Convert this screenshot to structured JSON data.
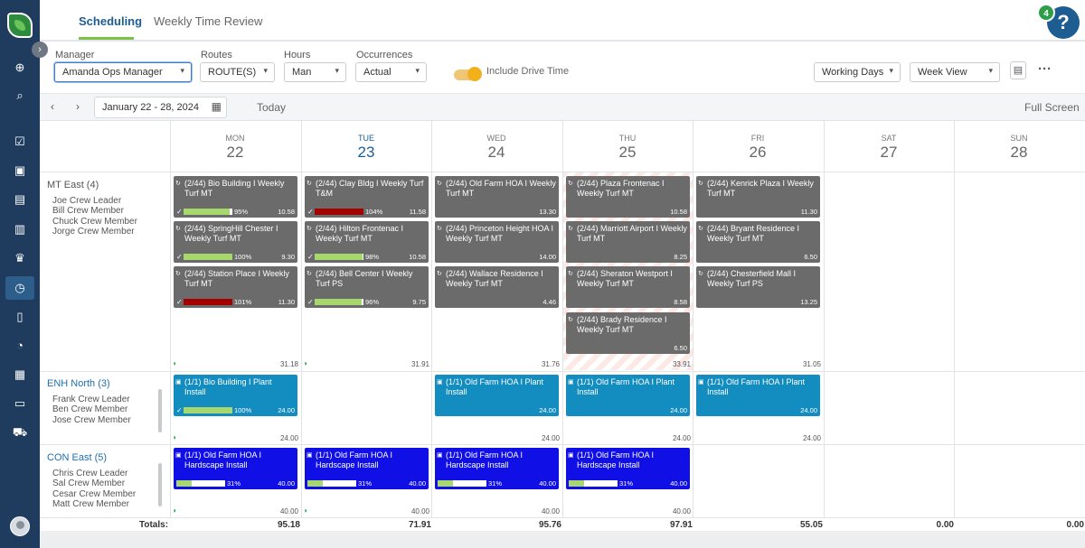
{
  "tabs": [
    {
      "label": "Scheduling"
    },
    {
      "label": "Weekly Time Review"
    }
  ],
  "notifications": {
    "count": "4",
    "help": "?"
  },
  "filters": {
    "manager": {
      "label": "Manager",
      "value": "Amanda Ops Manager"
    },
    "routes": {
      "label": "Routes",
      "value": "ROUTE(S)"
    },
    "hours": {
      "label": "Hours",
      "value": "Man"
    },
    "occurrences": {
      "label": "Occurrences",
      "value": "Actual"
    },
    "include_drive_time": "Include Drive Time",
    "working_days": "Working Days",
    "view": "Week View"
  },
  "nav": {
    "range": "January 22 - 28, 2024",
    "today": "Today",
    "fullscreen": "Full Screen"
  },
  "days": [
    {
      "name": "MON",
      "num": "22"
    },
    {
      "name": "TUE",
      "num": "23"
    },
    {
      "name": "WED",
      "num": "24"
    },
    {
      "name": "THU",
      "num": "25"
    },
    {
      "name": "FRI",
      "num": "26"
    },
    {
      "name": "SAT",
      "num": "27"
    },
    {
      "name": "SUN",
      "num": "28"
    }
  ],
  "crews": [
    {
      "name": "MT East (4)",
      "members": [
        "Joe Crew Leader",
        "Bill Crew Member",
        "Chuck Crew Member",
        "Jorge Crew Member"
      ],
      "totals": [
        "31.18",
        "31.91",
        "31.76",
        "33.91",
        "31.05"
      ]
    },
    {
      "name": "ENH North (3)",
      "members": [
        "Frank Crew Leader",
        "Ben Crew Member",
        "Jose Crew Member"
      ],
      "totals": [
        "24.00",
        "",
        "24.00",
        "24.00",
        "24.00"
      ]
    },
    {
      "name": "CON East (5)",
      "members": [
        "Chris Crew Leader",
        "Sal Crew Member",
        "Cesar Crew Member",
        "Matt Crew Member"
      ],
      "totals": [
        "40.00",
        "40.00",
        "40.00",
        "40.00",
        ""
      ]
    }
  ],
  "cards": {
    "c1": {
      "title": "(2/44) Bio Building I Weekly Turf MT",
      "hours": "10.58",
      "pct": "95%"
    },
    "c2": {
      "title": "(2/44) SpringHill Chester I Weekly Turf MT",
      "hours": "9.30",
      "pct": "100%"
    },
    "c3": {
      "title": "(2/44) Station Place I Weekly Turf MT",
      "hours": "11.30",
      "pct": "101%"
    },
    "c4": {
      "title": "(2/44) Clay Bldg I Weekly Turf T&M",
      "hours": "11.58",
      "pct": "104%"
    },
    "c5": {
      "title": "(2/44) Hilton Frontenac I Weekly Turf MT",
      "hours": "10.58",
      "pct": "98%"
    },
    "c6": {
      "title": "(2/44) Bell Center I Weekly Turf PS",
      "hours": "9.75",
      "pct": "96%"
    },
    "c7": {
      "title": "(2/44) Old Farm HOA I Weekly Turf MT",
      "hours": "13.30"
    },
    "c8": {
      "title": "(2/44) Princeton Height HOA I Weekly Turf MT",
      "hours": "14.00"
    },
    "c9": {
      "title": "(2/44) Wallace Residence I Weekly Turf MT",
      "hours": "4.46"
    },
    "c10": {
      "title": "(2/44) Plaza Frontenac I Weekly Turf MT",
      "hours": "10.58"
    },
    "c11": {
      "title": "(2/44) Marriott Airport I Weekly Turf MT",
      "hours": "8.25"
    },
    "c12": {
      "title": "(2/44) Sheraton Westport I Weekly Turf MT",
      "hours": "8.58"
    },
    "c13": {
      "title": "(2/44) Brady Residence I Weekly Turf MT",
      "hours": "6.50"
    },
    "c14": {
      "title": "(2/44) Kenrick Plaza I Weekly Turf MT",
      "hours": "11.30"
    },
    "c15": {
      "title": "(2/44) Bryant Residence I Weekly Turf MT",
      "hours": "6.50"
    },
    "c16": {
      "title": "(2/44) Chesterfield Mall I Weekly Turf PS",
      "hours": "13.25"
    },
    "e1": {
      "title": "(1/1) Bio Building I Plant Install",
      "hours": "24.00",
      "pct": "100%"
    },
    "e2": {
      "title": "(1/1) Old Farm HOA I Plant Install",
      "hours": "24.00"
    },
    "e3": {
      "title": "(1/1) Old Farm HOA I Plant Install",
      "hours": "24.00"
    },
    "e4": {
      "title": "(1/1) Old Farm HOA I Plant Install",
      "hours": "24.00"
    },
    "h1": {
      "title": "(1/1) Old Farm HOA I Hardscape Install",
      "hours": "40.00",
      "pct": "31%"
    },
    "h2": {
      "title": "(1/1) Old Farm HOA I Hardscape Install",
      "hours": "40.00",
      "pct": "31%"
    },
    "h3": {
      "title": "(1/1) Old Farm HOA I Hardscape Install",
      "hours": "40.00",
      "pct": "31%"
    },
    "h4": {
      "title": "(1/1) Old Farm HOA I Hardscape Install",
      "hours": "40.00",
      "pct": "31%"
    }
  },
  "totals": {
    "label": "Totals:",
    "values": [
      "95.18",
      "71.91",
      "95.76",
      "97.91",
      "55.05",
      "0.00",
      "0.00"
    ]
  },
  "colors": {
    "accent": "#1d5d92",
    "green": "#7cc243",
    "grey_card": "#6b6b6b",
    "teal_card": "#138dbf",
    "blue_card": "#1010e6",
    "over_budget": "#a30000"
  }
}
